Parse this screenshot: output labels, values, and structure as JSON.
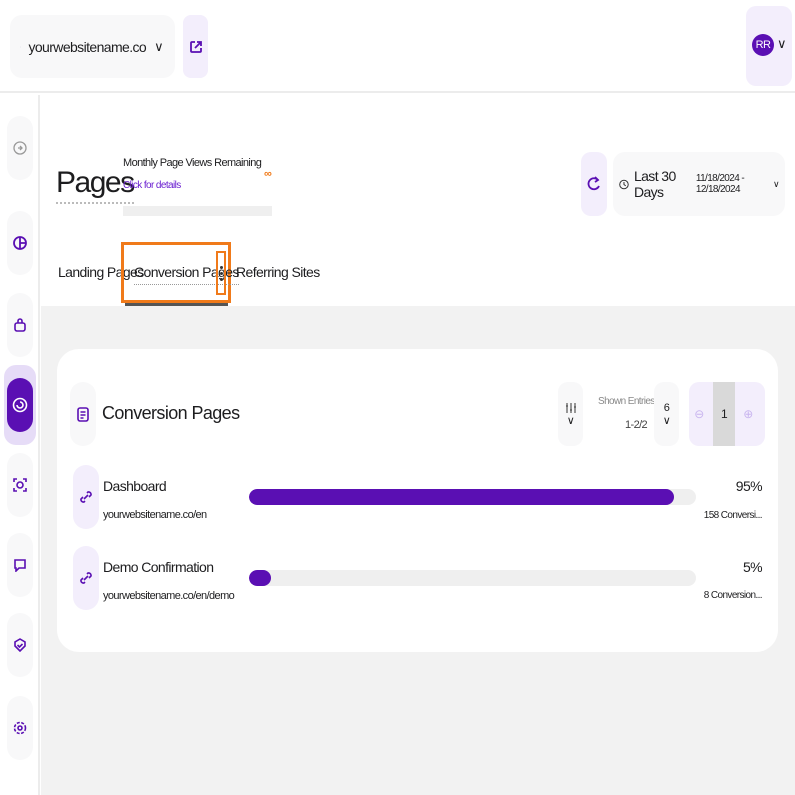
{
  "header": {
    "site": "yourwebsitename.co",
    "avatar": "RR"
  },
  "sidebar": {
    "items": [
      "collapse",
      "analytics",
      "shopping",
      "pages",
      "focus",
      "feedback",
      "security",
      "settings"
    ],
    "active": "pages"
  },
  "page": {
    "title": "Pages",
    "monthly_label": "Monthly Page Views Remaining",
    "details_link": "Click for details",
    "remaining": "∞",
    "range_label": "Last 30 Days",
    "range_dates": "11/18/2024 - 12/18/2024"
  },
  "tabs": [
    {
      "label": "Landing Pages"
    },
    {
      "label": "Conversion Pages",
      "selected": true
    },
    {
      "label": "Referring Sites"
    }
  ],
  "card": {
    "title": "Conversion Pages",
    "shown_entries_label": "Shown Entries",
    "shown_entries_value": "1-2/2",
    "per_page": "6",
    "current_page": "1",
    "rows": [
      {
        "name": "Dashboard",
        "url": "yourwebsitename.co/en",
        "percent": 95,
        "percent_label": "95%",
        "count": "158 Conversi..."
      },
      {
        "name": "Demo Confirmation",
        "url": "yourwebsitename.co/en/demo",
        "percent": 5,
        "percent_label": "5%",
        "count": "8 Conversion..."
      }
    ]
  },
  "colors": {
    "accent": "#5a0fb3",
    "highlight": "#f07a1a"
  }
}
